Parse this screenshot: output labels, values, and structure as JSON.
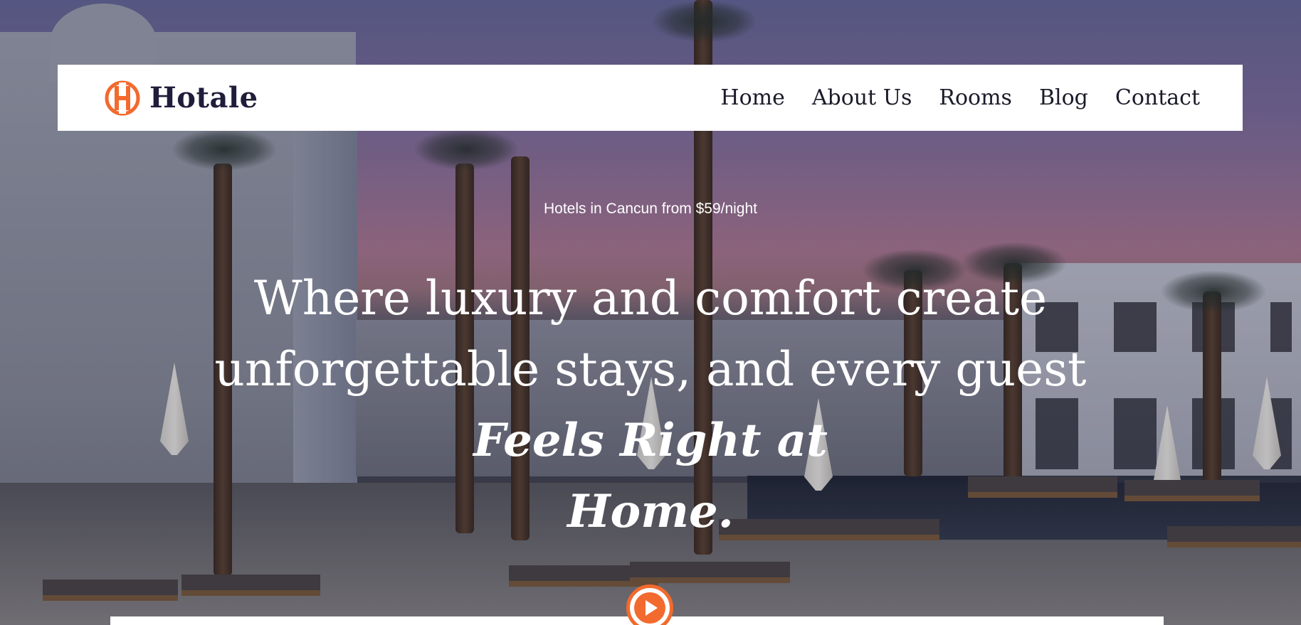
{
  "brand": {
    "name": "Hotale",
    "logo_icon": "hotale-h-logo-icon",
    "accent_color": "#f26a2e",
    "text_color": "#1f1d3a"
  },
  "nav": {
    "items": [
      {
        "label": "Home"
      },
      {
        "label": "About Us"
      },
      {
        "label": "Rooms"
      },
      {
        "label": "Blog"
      },
      {
        "label": "Contact"
      }
    ]
  },
  "hero": {
    "tagline": "Hotels in Cancun from $59/night",
    "headline_line1": "Where luxury and comfort create",
    "headline_line2": "unforgettable stays, and every guest",
    "headline_em_line1": "Feels Right at",
    "headline_em_line2": "Home.",
    "play_icon": "play-icon"
  }
}
